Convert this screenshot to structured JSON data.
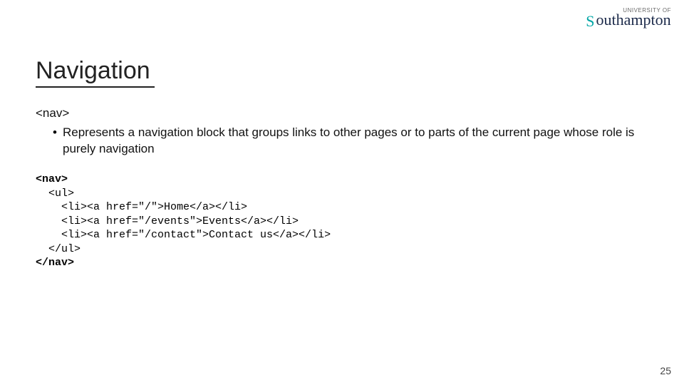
{
  "logo": {
    "line1": "UNIVERSITY OF",
    "line2_dolphin": "S",
    "line2_rest": "outhampton"
  },
  "title": "Navigation",
  "tag": "<nav>",
  "bullet": "Represents a navigation block that groups links to other pages or to parts of the current page whose role is purely navigation",
  "code": {
    "l1": "<nav>",
    "l2": "  <ul>",
    "l3": "    <li><a href=\"/\">Home</a></li>",
    "l4": "    <li><a href=\"/events\">Events</a></li>",
    "l5": "    <li><a href=\"/contact\">Contact us</a></li>",
    "l6": "  </ul>",
    "l7": "</nav>"
  },
  "page": "25"
}
